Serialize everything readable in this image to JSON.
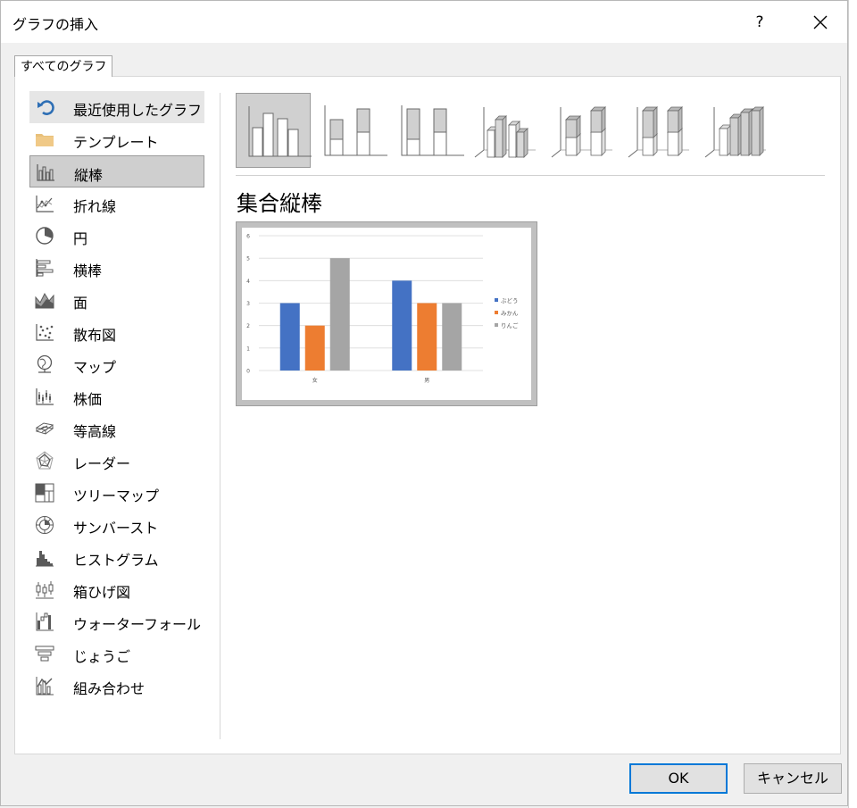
{
  "window": {
    "title": "グラフの挿入",
    "help_label": "?"
  },
  "tab": {
    "label": "すべてのグラフ"
  },
  "categories": [
    {
      "label": "最近使用したグラフ",
      "icon": "recent-icon",
      "state": "hover"
    },
    {
      "label": "テンプレート",
      "icon": "folder-icon",
      "state": ""
    },
    {
      "label": "縦棒",
      "icon": "column-chart-icon",
      "state": "selected"
    },
    {
      "label": "折れ線",
      "icon": "line-chart-icon",
      "state": ""
    },
    {
      "label": "円",
      "icon": "pie-chart-icon",
      "state": ""
    },
    {
      "label": "横棒",
      "icon": "bar-chart-icon",
      "state": ""
    },
    {
      "label": "面",
      "icon": "area-chart-icon",
      "state": ""
    },
    {
      "label": "散布図",
      "icon": "scatter-chart-icon",
      "state": ""
    },
    {
      "label": "マップ",
      "icon": "map-chart-icon",
      "state": ""
    },
    {
      "label": "株価",
      "icon": "stock-chart-icon",
      "state": ""
    },
    {
      "label": "等高線",
      "icon": "surface-chart-icon",
      "state": ""
    },
    {
      "label": "レーダー",
      "icon": "radar-chart-icon",
      "state": ""
    },
    {
      "label": "ツリーマップ",
      "icon": "treemap-chart-icon",
      "state": ""
    },
    {
      "label": "サンバースト",
      "icon": "sunburst-chart-icon",
      "state": ""
    },
    {
      "label": "ヒストグラム",
      "icon": "histogram-chart-icon",
      "state": ""
    },
    {
      "label": "箱ひげ図",
      "icon": "box-whisker-chart-icon",
      "state": ""
    },
    {
      "label": "ウォーターフォール",
      "icon": "waterfall-chart-icon",
      "state": ""
    },
    {
      "label": "じょうご",
      "icon": "funnel-chart-icon",
      "state": ""
    },
    {
      "label": "組み合わせ",
      "icon": "combo-chart-icon",
      "state": ""
    }
  ],
  "subtypes": [
    {
      "icon": "clustered-column-icon",
      "selected": true
    },
    {
      "icon": "stacked-column-icon",
      "selected": false
    },
    {
      "icon": "100-stacked-column-icon",
      "selected": false
    },
    {
      "icon": "3d-clustered-column-icon",
      "selected": false
    },
    {
      "icon": "3d-stacked-column-icon",
      "selected": false
    },
    {
      "icon": "3d-100-stacked-column-icon",
      "selected": false
    },
    {
      "icon": "3d-column-icon",
      "selected": false
    }
  ],
  "selected_subtype": {
    "title": "集合縦棒"
  },
  "chart_data": {
    "type": "bar",
    "categories": [
      "女",
      "男"
    ],
    "series": [
      {
        "name": "ぶどう",
        "values": [
          3,
          4
        ],
        "color": "#4472c4"
      },
      {
        "name": "みかん",
        "values": [
          2,
          3
        ],
        "color": "#ed7d31"
      },
      {
        "name": "りんご",
        "values": [
          5,
          3
        ],
        "color": "#a5a5a5"
      }
    ],
    "ylim": [
      0,
      6
    ],
    "yticks": [
      0,
      1,
      2,
      3,
      4,
      5,
      6
    ],
    "grid": true,
    "legend": "right"
  },
  "buttons": {
    "ok": "OK",
    "cancel": "キャンセル"
  }
}
